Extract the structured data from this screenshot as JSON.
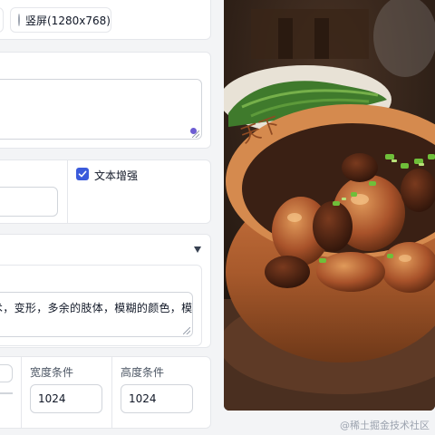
{
  "orientation": {
    "portrait_label": "竖屏(1280x768)"
  },
  "prompt": {
    "value": ""
  },
  "options": {
    "text_enhance_label": "文本增强",
    "text_enhance_checked": true
  },
  "negative": {
    "value": "术，变形，多余的肢体，模糊的颜色，模"
  },
  "size": {
    "width_label": "宽度条件",
    "width_value": "1024",
    "height_label": "高度条件",
    "height_value": "1024"
  },
  "image": {
    "alt": "food-photo",
    "emboss_text": "天下"
  },
  "watermark": "@稀土掘金技术社区",
  "colors": {
    "accent": "#3b5bdb",
    "grip_dot": "#6d5dd3"
  }
}
